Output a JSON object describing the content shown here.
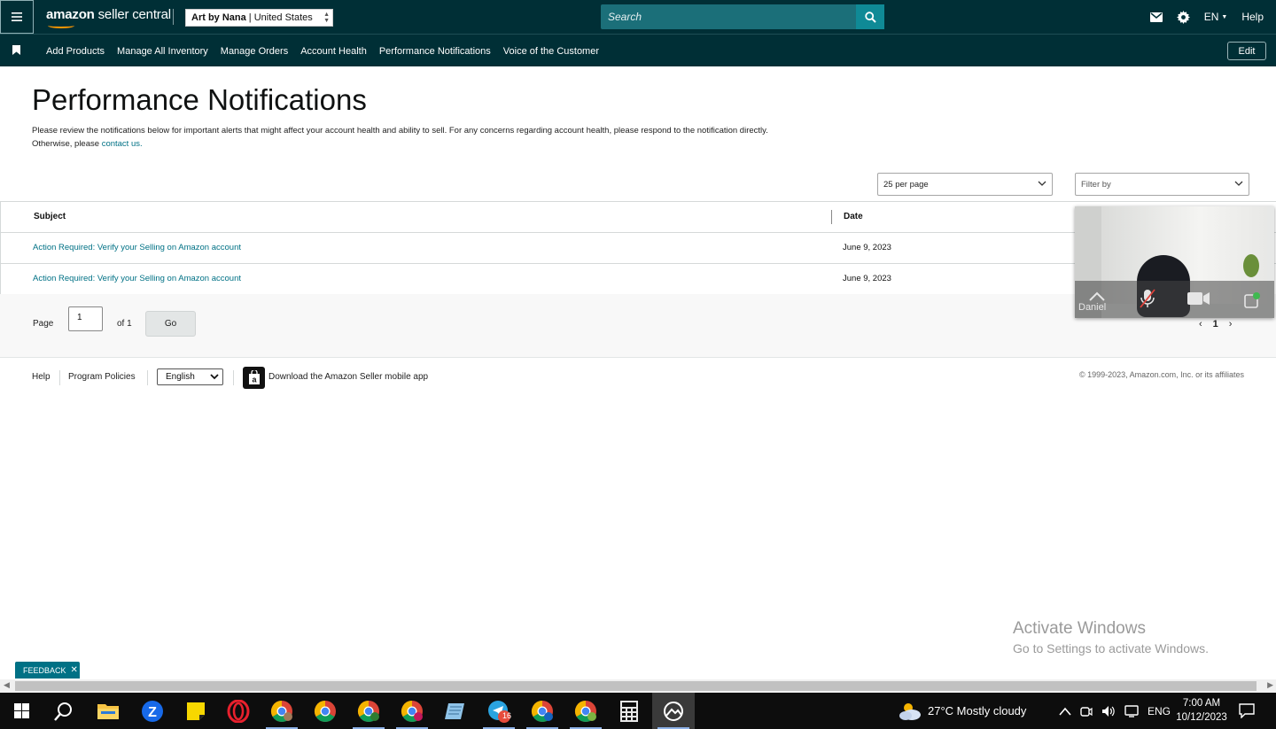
{
  "header": {
    "logo_brand": "amazon",
    "logo_product": "seller central",
    "account_name": "Art by Nana",
    "account_marketplace": "United States",
    "search_placeholder": "Search",
    "language": "EN",
    "help": "Help"
  },
  "nav": {
    "items": [
      "Add Products",
      "Manage All Inventory",
      "Manage Orders",
      "Account Health",
      "Performance Notifications",
      "Voice of the Customer"
    ],
    "edit": "Edit"
  },
  "page": {
    "title": "Performance Notifications",
    "desc_line1": "Please review the notifications below for important alerts that might affect your account health and ability to sell. For any concerns regarding account health, please respond to the notification directly.",
    "desc_line2_prefix": "Otherwise, please",
    "desc_link": "contact us.",
    "per_page": "25 per page",
    "filter_placeholder": "Filter by"
  },
  "table": {
    "columns": [
      "Subject",
      "Date"
    ],
    "rows": [
      {
        "subject": "Action Required: Verify your Selling on Amazon account",
        "date": "June 9, 2023"
      },
      {
        "subject": "Action Required: Verify your Selling on Amazon account",
        "date": "June 9, 2023"
      }
    ]
  },
  "pager": {
    "page_label": "Page",
    "page_value": "1",
    "of_label": "of 1",
    "go": "Go",
    "current": "1"
  },
  "footer": {
    "help": "Help",
    "policies": "Program Policies",
    "language": "English",
    "app": "Download the Amazon Seller mobile app",
    "copyright": "© 1999-2023, Amazon.com, Inc. or its affiliates"
  },
  "video": {
    "participant": "Daniel"
  },
  "watermark": {
    "line1": "Activate Windows",
    "line2": "Go to Settings to activate Windows."
  },
  "feedback": "FEEDBACK",
  "taskbar": {
    "weather": "27°C  Mostly cloudy",
    "lang": "ENG",
    "time": "7:00 AM",
    "date": "10/12/2023",
    "telegram_badge": "16"
  },
  "colors": {
    "header_bg": "#002f36",
    "link": "#007185",
    "search_bg": "#1b6f79"
  }
}
